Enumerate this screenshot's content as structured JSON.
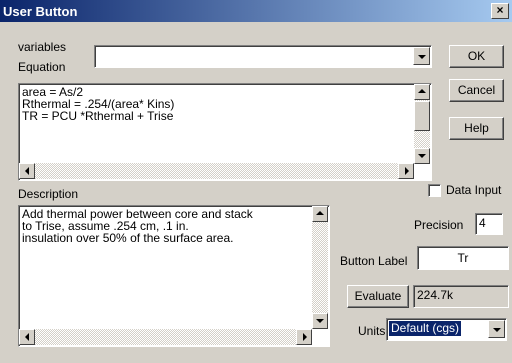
{
  "window": {
    "title": "User Button",
    "close_glyph": "×"
  },
  "variables": {
    "label": "variables",
    "value": ""
  },
  "equation": {
    "label": "Equation",
    "lines": [
      "area = As/2",
      "Rthermal = .254/(area* Kins)",
      "TR = PCU *Rthermal + Trise"
    ]
  },
  "buttons": {
    "ok": "OK",
    "cancel": "Cancel",
    "help": "Help",
    "evaluate": "Evaluate"
  },
  "description": {
    "label": "Description",
    "lines": [
      "Add thermal power between core and stack",
      "to Trise, assume .254 cm, .1 in.",
      "insulation over 50% of the surface area."
    ]
  },
  "data_input": {
    "label": "Data Input",
    "checked": false
  },
  "precision": {
    "label": "Precision",
    "value": "4"
  },
  "button_label": {
    "label": "Button Label",
    "value": "Tr"
  },
  "evaluate_result": "224.7k",
  "units": {
    "label": "Units",
    "selected": "Default (cgs)"
  },
  "colors": {
    "titlebar_start": "#0a246a",
    "titlebar_end": "#a6caf0",
    "face": "#d4d0c8",
    "highlight": "#0a246a"
  }
}
